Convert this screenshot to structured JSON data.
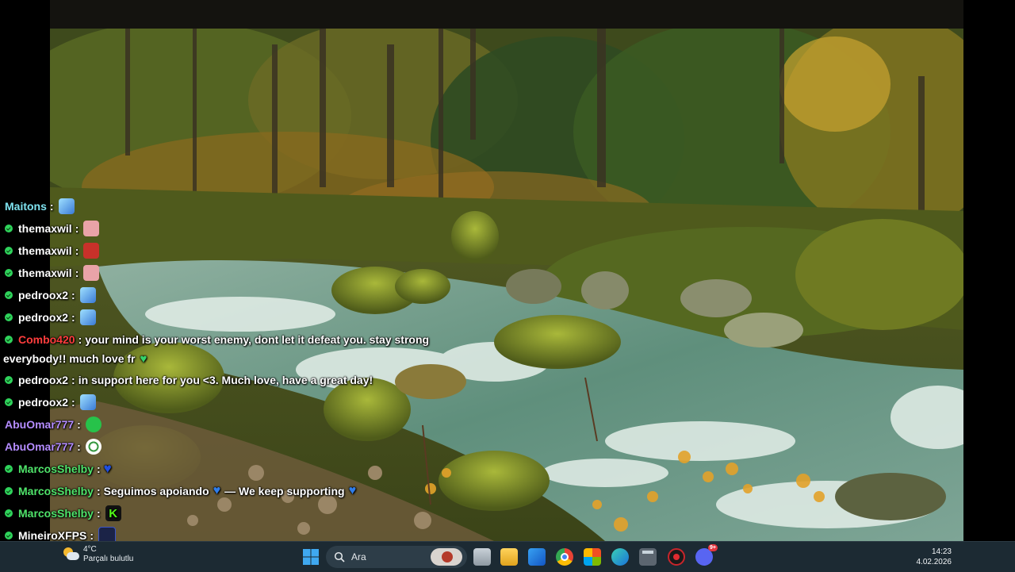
{
  "chat": {
    "messages": [
      {
        "user": "Maitons",
        "color": "#7fe3f0",
        "badge": false,
        "text": "",
        "emote": "butterfly"
      },
      {
        "user": "themaxwil",
        "color": "#ffffff",
        "badge": true,
        "text": "",
        "emote": "pig"
      },
      {
        "user": "themaxwil",
        "color": "#ffffff",
        "badge": true,
        "text": "",
        "emote": "red-face"
      },
      {
        "user": "themaxwil",
        "color": "#ffffff",
        "badge": true,
        "text": "",
        "emote": "pig"
      },
      {
        "user": "pedroox2",
        "color": "#ffffff",
        "badge": true,
        "text": "",
        "emote": "butterfly"
      },
      {
        "user": "pedroox2",
        "color": "#ffffff",
        "badge": true,
        "text": "",
        "emote": "butterfly"
      },
      {
        "user": "Combo420",
        "color": "#ff3d3d",
        "badge": true,
        "text": "your mind is your worst enemy, dont let it defeat you. stay strong",
        "emote": ""
      },
      {
        "user": "",
        "color": "#ffffff",
        "badge": false,
        "text": "everybody!! much love fr",
        "emote": "green-heart"
      },
      {
        "user": "pedroox2",
        "color": "#ffffff",
        "badge": true,
        "text": "in support here for you <3. Much love, have a great day!",
        "emote": ""
      },
      {
        "user": "pedroox2",
        "color": "#ffffff",
        "badge": true,
        "text": "",
        "emote": "butterfly"
      },
      {
        "user": "AbuOmar777",
        "color": "#b48cff",
        "badge": false,
        "text": "",
        "emote": "green-blob"
      },
      {
        "user": "AbuOmar777",
        "color": "#b48cff",
        "badge": false,
        "text": "",
        "emote": "ball"
      },
      {
        "user": "MarcosShelby",
        "color": "#4fe36a",
        "badge": true,
        "text": "",
        "emote": "blue-heart"
      },
      {
        "user": "MarcosShelby",
        "color": "#4fe36a",
        "badge": true,
        "text": "Seguimos apoiando",
        "emote": "blue-heart",
        "text2": "— We keep supporting",
        "emote2": "blue-heart"
      },
      {
        "user": "MarcosShelby",
        "color": "#4fe36a",
        "badge": true,
        "text": "",
        "emote": "kick-k"
      },
      {
        "user": "MineiroXFPS",
        "color": "#ffffff",
        "badge": true,
        "text": "",
        "emote": "w-logo"
      }
    ],
    "separator": ":"
  },
  "taskbar": {
    "weather_temp": "4°C",
    "weather_desc": "Parçalı bulutlu",
    "search_placeholder": "Ara",
    "time": "14:23",
    "date": "4.02.2026",
    "icons": [
      "windows-start-icon",
      "search-icon",
      "widgets-icon",
      "task-view-icon",
      "file-explorer-icon",
      "outlook-icon",
      "chrome-icon",
      "microsoft-store-icon",
      "edge-icon",
      "calculator-icon",
      "record-icon",
      "discord-icon"
    ],
    "discord_badge": "9+"
  }
}
